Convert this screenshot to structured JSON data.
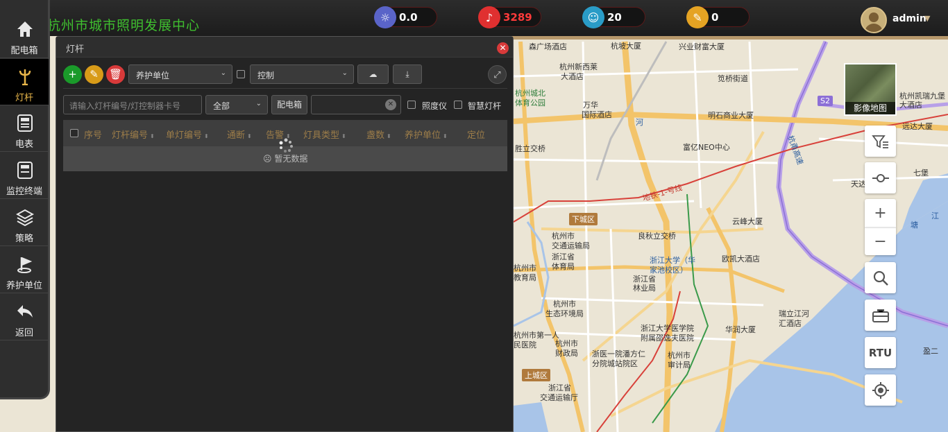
{
  "header": {
    "title": "杭州市城市照明发展中心",
    "stats": [
      {
        "name": "power",
        "value": "0.0",
        "color": "#5a64c8",
        "icon": "sun-icon",
        "text_color": "#ffffff"
      },
      {
        "name": "alarms",
        "value": "3289",
        "color": "#e03030",
        "icon": "bell-icon",
        "text_color": "#ff3b3b"
      },
      {
        "name": "users",
        "value": "20",
        "color": "#2a9cc7",
        "icon": "user-icon",
        "text_color": "#ffffff"
      },
      {
        "name": "tasks",
        "value": "0",
        "color": "#e5a323",
        "icon": "edit-icon",
        "text_color": "#ffffff"
      }
    ],
    "user": {
      "name": "admin"
    }
  },
  "nav": {
    "items": [
      {
        "label": "配电箱",
        "icon": "home-icon"
      },
      {
        "label": "灯杆",
        "icon": "lamp-pole-icon"
      },
      {
        "label": "电表",
        "icon": "meter-icon"
      },
      {
        "label": "监控终端",
        "icon": "terminal-icon"
      },
      {
        "label": "策略",
        "icon": "layers-icon"
      },
      {
        "label": "养护单位",
        "icon": "flag-icon"
      },
      {
        "label": "返回",
        "icon": "back-icon"
      }
    ],
    "active": "灯杆"
  },
  "panel": {
    "title": "灯杆",
    "toolbar": {
      "maintenance_select": "养护单位",
      "control_select": "控制"
    },
    "filter": {
      "search_placeholder": "请输入灯杆编号/灯控制器卡号",
      "status_select": "全部",
      "distribution_box_button": "配电箱",
      "illuminometer_label": "照度仪",
      "smart_pole_label": "智慧灯杆"
    },
    "table": {
      "columns": [
        "序号",
        "灯杆编号",
        "单灯编号",
        "通断",
        "告警",
        "灯具类型",
        "盏数",
        "养护单位",
        "定位"
      ],
      "empty_text": "暂无数据"
    }
  },
  "map": {
    "satellite_label": "影像地图",
    "rtu_label": "RTU",
    "districts": [
      "下城区",
      "上城区"
    ],
    "metro_label": "地铁-1-号线",
    "highway_labels": [
      "杭甬高速",
      "S2"
    ],
    "poi": [
      "森广场酒店",
      "杭坡大厦",
      "兴业财富大厦",
      "杭州新西莱",
      "大酒店",
      "笕桥街道",
      "杭州城北",
      "体育公园",
      "万华",
      "国际酒店",
      "杭州凯瑞",
      "大酒店",
      "九堡",
      "明石商业大厦",
      "远达大厦",
      "胜立交桥",
      "富亿NEO中心",
      "天达",
      "七堡",
      "云峰大厦",
      "良秋立交桥",
      "杭州市",
      "交通运输局",
      "浙江省",
      "体育局",
      "浙江大学（华",
      "家池校区）",
      "欧凯大酒店",
      "杭州市",
      "教育局",
      "浙江省",
      "林业局",
      "杭州市",
      "生态环境局",
      "瑞立江河",
      "汇酒店",
      "浙江大学医学院",
      "附属邵逸夫医院",
      "华润大厦",
      "杭州市第一人",
      "民医院",
      "杭州市",
      "财政局",
      "浙医一院潘方仁",
      "分院城站院区",
      "杭州市",
      "审计局",
      "浙江省",
      "交通运输厅",
      "江",
      "塘",
      "河",
      "盈二"
    ]
  }
}
